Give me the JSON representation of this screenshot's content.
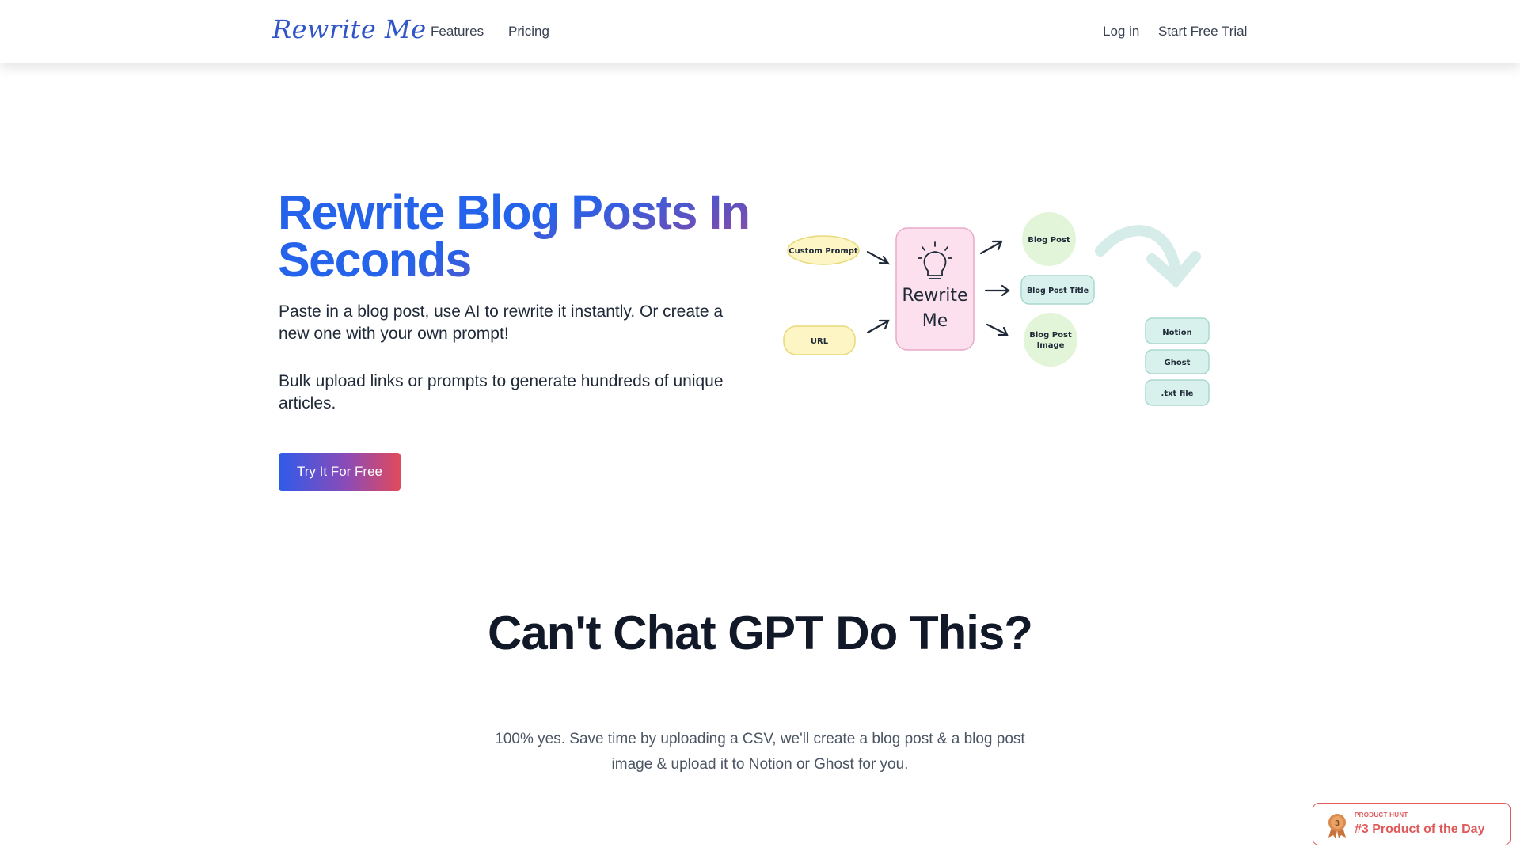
{
  "nav": {
    "logo": "Rewrite Me",
    "links": [
      "Features",
      "Pricing"
    ],
    "login": "Log in",
    "trial": "Start Free Trial"
  },
  "hero": {
    "title": "Rewrite Blog Posts In Seconds",
    "paragraph1": "Paste in a blog post, use AI to rewrite it instantly. Or create a new one with your own prompt!",
    "paragraph2": "Bulk upload links or prompts to generate hundreds of unique articles.",
    "cta": "Try It For Free"
  },
  "diagram": {
    "inputs": [
      "Custom Prompt",
      "URL"
    ],
    "center_line1": "Rewrite",
    "center_line2": "Me",
    "outputs": [
      "Blog Post",
      "Blog Post Title",
      "Blog Post Image"
    ],
    "destinations": [
      "Notion",
      "Ghost",
      ".txt file"
    ]
  },
  "section2": {
    "title": "Can't Chat GPT Do This?",
    "subtitle": "100% yes. Save time by uploading a CSV, we'll create a blog post & a blog post image & upload it to Notion or Ghost for you."
  },
  "badge": {
    "small": "PRODUCT HUNT",
    "big": "#3 Product of the Day",
    "medal_number": "3"
  }
}
